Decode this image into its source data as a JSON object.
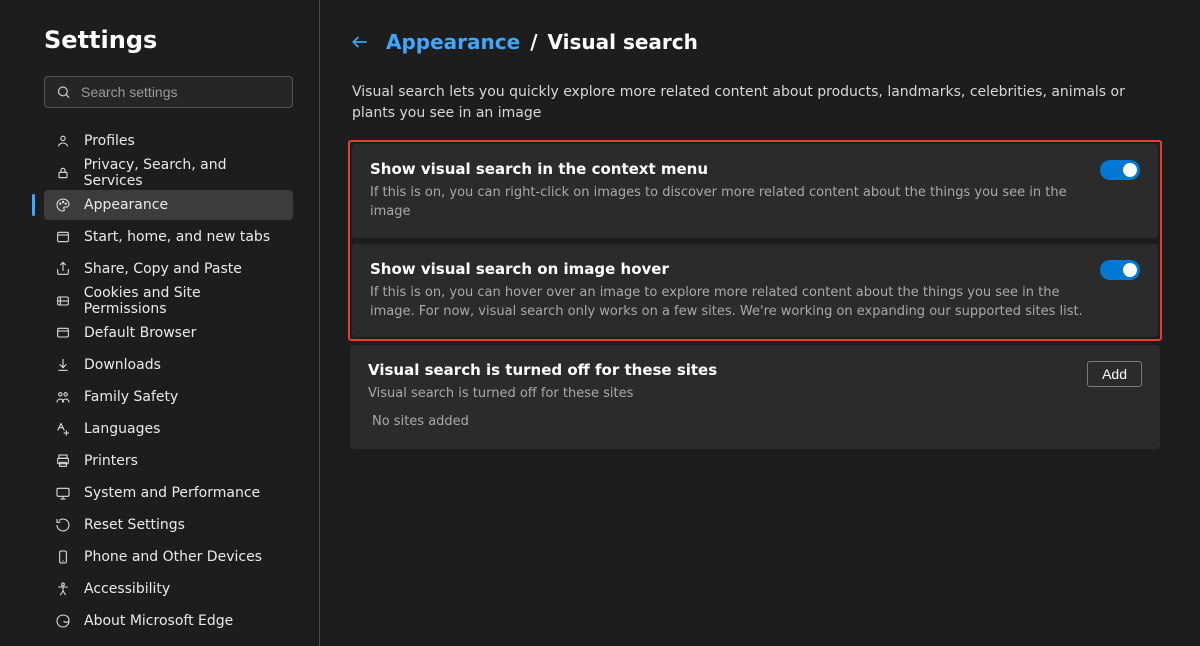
{
  "app": {
    "title": "Settings"
  },
  "search": {
    "placeholder": "Search settings"
  },
  "sidebar": {
    "items": [
      {
        "label": "Profiles"
      },
      {
        "label": "Privacy, Search, and Services"
      },
      {
        "label": "Appearance"
      },
      {
        "label": "Start, home, and new tabs"
      },
      {
        "label": "Share, Copy and Paste"
      },
      {
        "label": "Cookies and Site Permissions"
      },
      {
        "label": "Default Browser"
      },
      {
        "label": "Downloads"
      },
      {
        "label": "Family Safety"
      },
      {
        "label": "Languages"
      },
      {
        "label": "Printers"
      },
      {
        "label": "System and Performance"
      },
      {
        "label": "Reset Settings"
      },
      {
        "label": "Phone and Other Devices"
      },
      {
        "label": "Accessibility"
      },
      {
        "label": "About Microsoft Edge"
      }
    ]
  },
  "breadcrumb": {
    "parent": "Appearance",
    "separator": "/",
    "current": "Visual search"
  },
  "intro": "Visual search lets you quickly explore more related content about products, landmarks, celebrities, animals or plants you see in an image",
  "cards": {
    "context_menu": {
      "title": "Show visual search in the context menu",
      "desc": "If this is on, you can right-click on images to discover more related content about the things you see in the image",
      "enabled": true
    },
    "hover": {
      "title": "Show visual search on image hover",
      "desc": "If this is on, you can hover over an image to explore more related content about the things you see in the image. For now, visual search only works on a few sites. We're working on expanding our supported sites list.",
      "enabled": true
    },
    "blocklist": {
      "title": "Visual search is turned off for these sites",
      "desc": "Visual search is turned off for these sites",
      "button": "Add",
      "empty": "No sites added"
    }
  },
  "colors": {
    "accent": "#0078d4",
    "link": "#3ea7ff",
    "highlight": "#e63e2e"
  }
}
